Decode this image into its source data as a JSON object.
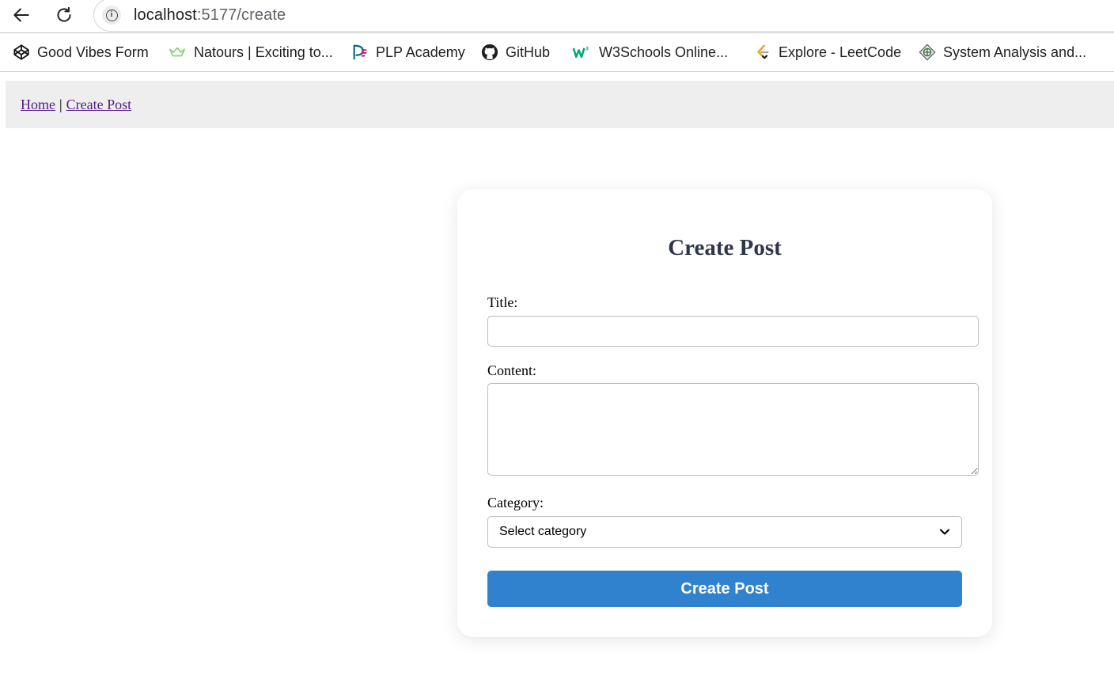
{
  "browser": {
    "url_host": "localhost",
    "url_path": ":5177/create"
  },
  "bookmarks": [
    {
      "label": "Good Vibes Form",
      "icon": "codepen-icon"
    },
    {
      "label": "Natours | Exciting to...",
      "icon": "natours-crown-icon"
    },
    {
      "label": "PLP Academy",
      "icon": "plp-logo-icon"
    },
    {
      "label": "GitHub",
      "icon": "github-icon"
    },
    {
      "label": "W3Schools Online...",
      "icon": "w3schools-icon"
    },
    {
      "label": "Explore - LeetCode",
      "icon": "leetcode-icon"
    },
    {
      "label": "System Analysis and...",
      "icon": "system-analysis-icon"
    }
  ],
  "nav": {
    "home": "Home",
    "separator": "|",
    "create": "Create Post"
  },
  "form": {
    "heading": "Create Post",
    "title_label": "Title:",
    "title_value": "",
    "content_label": "Content:",
    "content_value": "",
    "category_label": "Category:",
    "category_selected": "Select category",
    "submit_label": "Create Post"
  },
  "colors": {
    "primary_button": "#3182ce",
    "heading": "#2d3748",
    "link_visited": "#551a8b",
    "nav_background": "#eeeeee"
  }
}
